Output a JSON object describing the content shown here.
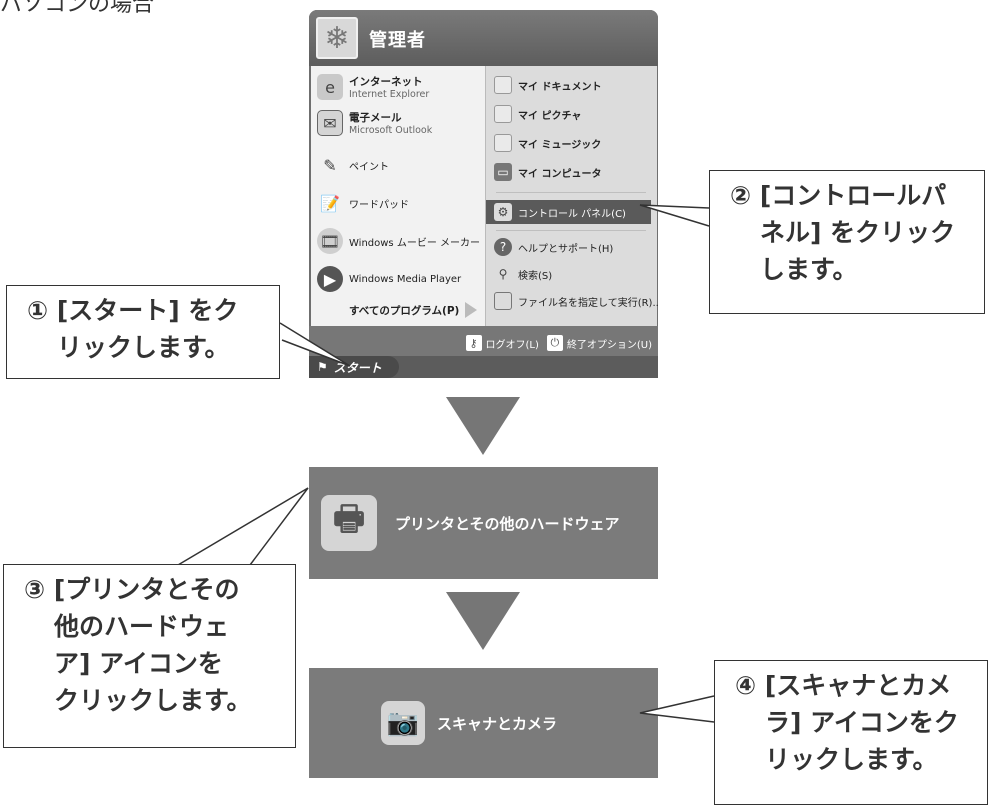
{
  "header_fragment": "パソコンの場合",
  "start_menu": {
    "user_name": "管理者",
    "left_items": [
      {
        "title": "インターネット",
        "subtitle": "Internet Explorer",
        "icon": "internet-explorer-icon"
      },
      {
        "title": "電子メール",
        "subtitle": "Microsoft Outlook",
        "icon": "outlook-icon"
      },
      {
        "title": "ペイント",
        "icon": "paint-icon"
      },
      {
        "title": "ワードパッド",
        "icon": "wordpad-icon"
      },
      {
        "title": "Windows ムービー メーカー",
        "icon": "movie-maker-icon"
      },
      {
        "title": "Windows Media Player",
        "icon": "media-player-icon"
      }
    ],
    "all_programs": "すべてのプログラム(P)",
    "right_items": [
      {
        "label": "マイ ドキュメント",
        "icon": "folder-icon"
      },
      {
        "label": "マイ ピクチャ",
        "icon": "folder-icon"
      },
      {
        "label": "マイ ミュージック",
        "icon": "folder-icon"
      },
      {
        "label": "マイ コンピュータ",
        "icon": "computer-icon"
      },
      {
        "label": "コントロール パネル(C)",
        "icon": "control-panel-icon"
      },
      {
        "label": "ヘルプとサポート(H)",
        "icon": "help-icon"
      },
      {
        "label": "検索(S)",
        "icon": "search-icon"
      },
      {
        "label": "ファイル名を指定して実行(R)...",
        "icon": "run-icon"
      }
    ],
    "logoff": "ログオフ(L)",
    "shutdown": "終了オプション(U)",
    "start_button": "スタート"
  },
  "bar1_label": "プリンタとその他のハードウェア",
  "bar2_label": "スキャナとカメラ",
  "callouts": {
    "c1": [
      "① [スタート] をク",
      "リックします。"
    ],
    "c2": [
      "② [コントロールパ",
      "ネル] をクリック",
      "します。"
    ],
    "c3": [
      "③ [プリンタとその",
      "他のハードウェ",
      "ア] アイコンを",
      "クリックします。"
    ],
    "c4": [
      "④ [スキャナとカメ",
      "ラ] アイコンをク",
      "リックします。"
    ]
  }
}
